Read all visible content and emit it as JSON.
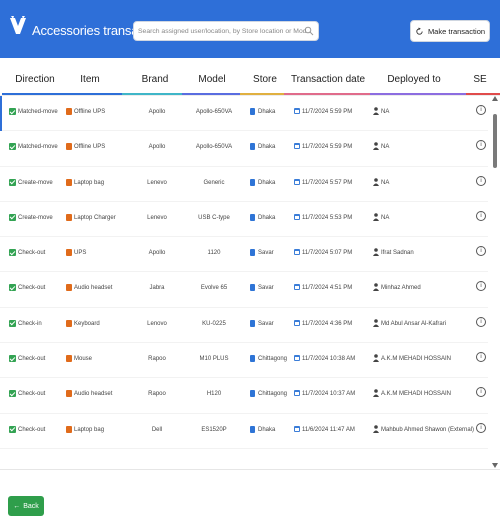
{
  "header": {
    "title": "Accessories transactions",
    "search_placeholder": "Search assigned user/location, by Store location or Model typed exactly",
    "make_transaction_label": "Make transaction"
  },
  "colors": {
    "header_bg": "#2e6fd8",
    "check_green": "#33a353",
    "item_icon_orange": "#e06b1b",
    "back_button_green": "#2f9e4b"
  },
  "table": {
    "columns": [
      {
        "label": "Direction",
        "accent": "#2e6fd8"
      },
      {
        "label": "Item",
        "accent": "#2e6fd8"
      },
      {
        "label": "Brand",
        "accent": "#3fb6c8"
      },
      {
        "label": "Model",
        "accent": "#5a6de0"
      },
      {
        "label": "Store",
        "accent": "#e0b040"
      },
      {
        "label": "Transaction date",
        "accent": "#e06b8b"
      },
      {
        "label": "Deployed to",
        "accent": "#8c6de0"
      },
      {
        "label": "SE",
        "accent": "#e04b4b"
      }
    ],
    "rows": [
      {
        "direction": "Matched-move",
        "item": "Offline UPS",
        "brand": "Apollo",
        "model": "Apollo-650VA",
        "store": "Dhaka",
        "date": "11/7/2024 5:59 PM",
        "deployed_to": "NA"
      },
      {
        "direction": "Matched-move",
        "item": "Offline UPS",
        "brand": "Apollo",
        "model": "Apollo-650VA",
        "store": "Dhaka",
        "date": "11/7/2024 5:59 PM",
        "deployed_to": "NA"
      },
      {
        "direction": "Create-move",
        "item": "Laptop bag",
        "brand": "Lenevo",
        "model": "Generic",
        "store": "Dhaka",
        "date": "11/7/2024 5:57 PM",
        "deployed_to": "NA"
      },
      {
        "direction": "Create-move",
        "item": "Laptop Charger",
        "brand": "Lenevo",
        "model": "USB C-type",
        "store": "Dhaka",
        "date": "11/7/2024 5:53 PM",
        "deployed_to": "NA"
      },
      {
        "direction": "Check-out",
        "item": "UPS",
        "brand": "Apollo",
        "model": "1120",
        "store": "Savar",
        "date": "11/7/2024 5:07 PM",
        "deployed_to": "Ifrat Sadnan"
      },
      {
        "direction": "Check-out",
        "item": "Audio headset",
        "brand": "Jabra",
        "model": "Evolve 65",
        "store": "Savar",
        "date": "11/7/2024 4:51 PM",
        "deployed_to": "Minhaz Ahmed"
      },
      {
        "direction": "Check-in",
        "item": "Keyboard",
        "brand": "Lenovo",
        "model": "KU-0225",
        "store": "Savar",
        "date": "11/7/2024 4:36 PM",
        "deployed_to": "Md Abul Ansar Al-Kafrari"
      },
      {
        "direction": "Check-out",
        "item": "Mouse",
        "brand": "Rapoo",
        "model": "M10 PLUS",
        "store": "Chittagong",
        "date": "11/7/2024 10:38 AM",
        "deployed_to": "A.K.M MEHADI HOSSAIN"
      },
      {
        "direction": "Check-out",
        "item": "Audio headset",
        "brand": "Rapoo",
        "model": "H120",
        "store": "Chittagong",
        "date": "11/7/2024 10:37 AM",
        "deployed_to": "A.K.M MEHADI HOSSAIN"
      },
      {
        "direction": "Check-out",
        "item": "Laptop bag",
        "brand": "Dell",
        "model": "ES1520P",
        "store": "Dhaka",
        "date": "11/6/2024 11:47 AM",
        "deployed_to": "Mahbub Ahmed Shawon (External)"
      }
    ]
  },
  "footer": {
    "back_label": "Back"
  }
}
